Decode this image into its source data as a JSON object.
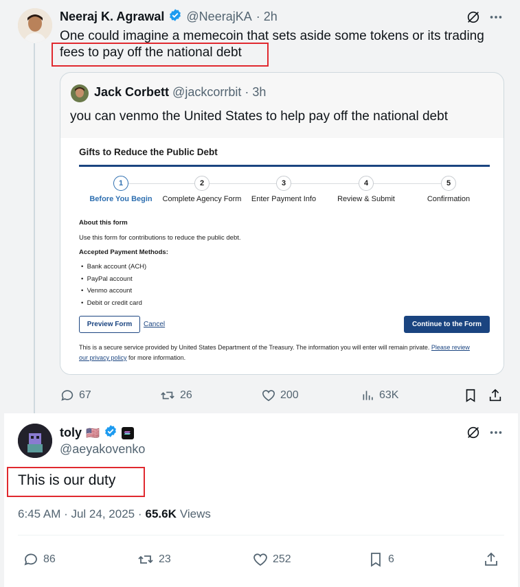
{
  "parent_tweet": {
    "author_name": "Neeraj K. Agrawal",
    "author_handle": "@NeerajKA",
    "time": "· 2h",
    "text_line1": "One could imagine a memecoin that sets aside some tokens or its trading",
    "text_line2": "fees to pay off the national debt",
    "actions": {
      "replies": "67",
      "retweets": "26",
      "likes": "200",
      "views": "63K"
    }
  },
  "quoted_tweet": {
    "author_name": "Jack Corbett",
    "author_handle": "@jackcorrbit",
    "time": "· 3h",
    "text": "you can venmo the United States to help pay off the national debt"
  },
  "treasury_form": {
    "title": "Gifts to Reduce the Public Debt",
    "steps": [
      {
        "num": "1",
        "label": "Before You Begin"
      },
      {
        "num": "2",
        "label": "Complete Agency Form"
      },
      {
        "num": "3",
        "label": "Enter Payment Info"
      },
      {
        "num": "4",
        "label": "Review & Submit"
      },
      {
        "num": "5",
        "label": "Confirmation"
      }
    ],
    "about_heading": "About this form",
    "about_text": "Use this form for contributions to reduce the public debt.",
    "methods_heading": "Accepted Payment Methods:",
    "methods": [
      "Bank account (ACH)",
      "PayPal account",
      "Venmo account",
      "Debit or credit card"
    ],
    "preview_button": "Preview Form",
    "cancel_link": "Cancel",
    "continue_button": "Continue to the Form",
    "footer_text": "This is a secure service provided by United States Department of the Treasury. The information you will enter will remain private.",
    "footer_link1": "Please review",
    "footer_link2": "our privacy policy",
    "footer_tail": "for more information.",
    "accent_color": "#1a4480",
    "active_step_color": "#2e6fb0"
  },
  "main_tweet": {
    "author_name": "toly",
    "author_flag": "🇺🇸",
    "author_handle": "@aeyakovenko",
    "text": "This is our duty",
    "timestamp": "6:45 AM · Jul 24, 2025 ·",
    "views_count": "65.6K",
    "views_label": "Views",
    "actions": {
      "replies": "86",
      "retweets": "23",
      "likes": "252",
      "bookmarks": "6"
    }
  },
  "colors": {
    "verified_blue": "#1d9bf0",
    "highlight_red": "#e0282e",
    "muted_text": "#536471"
  }
}
